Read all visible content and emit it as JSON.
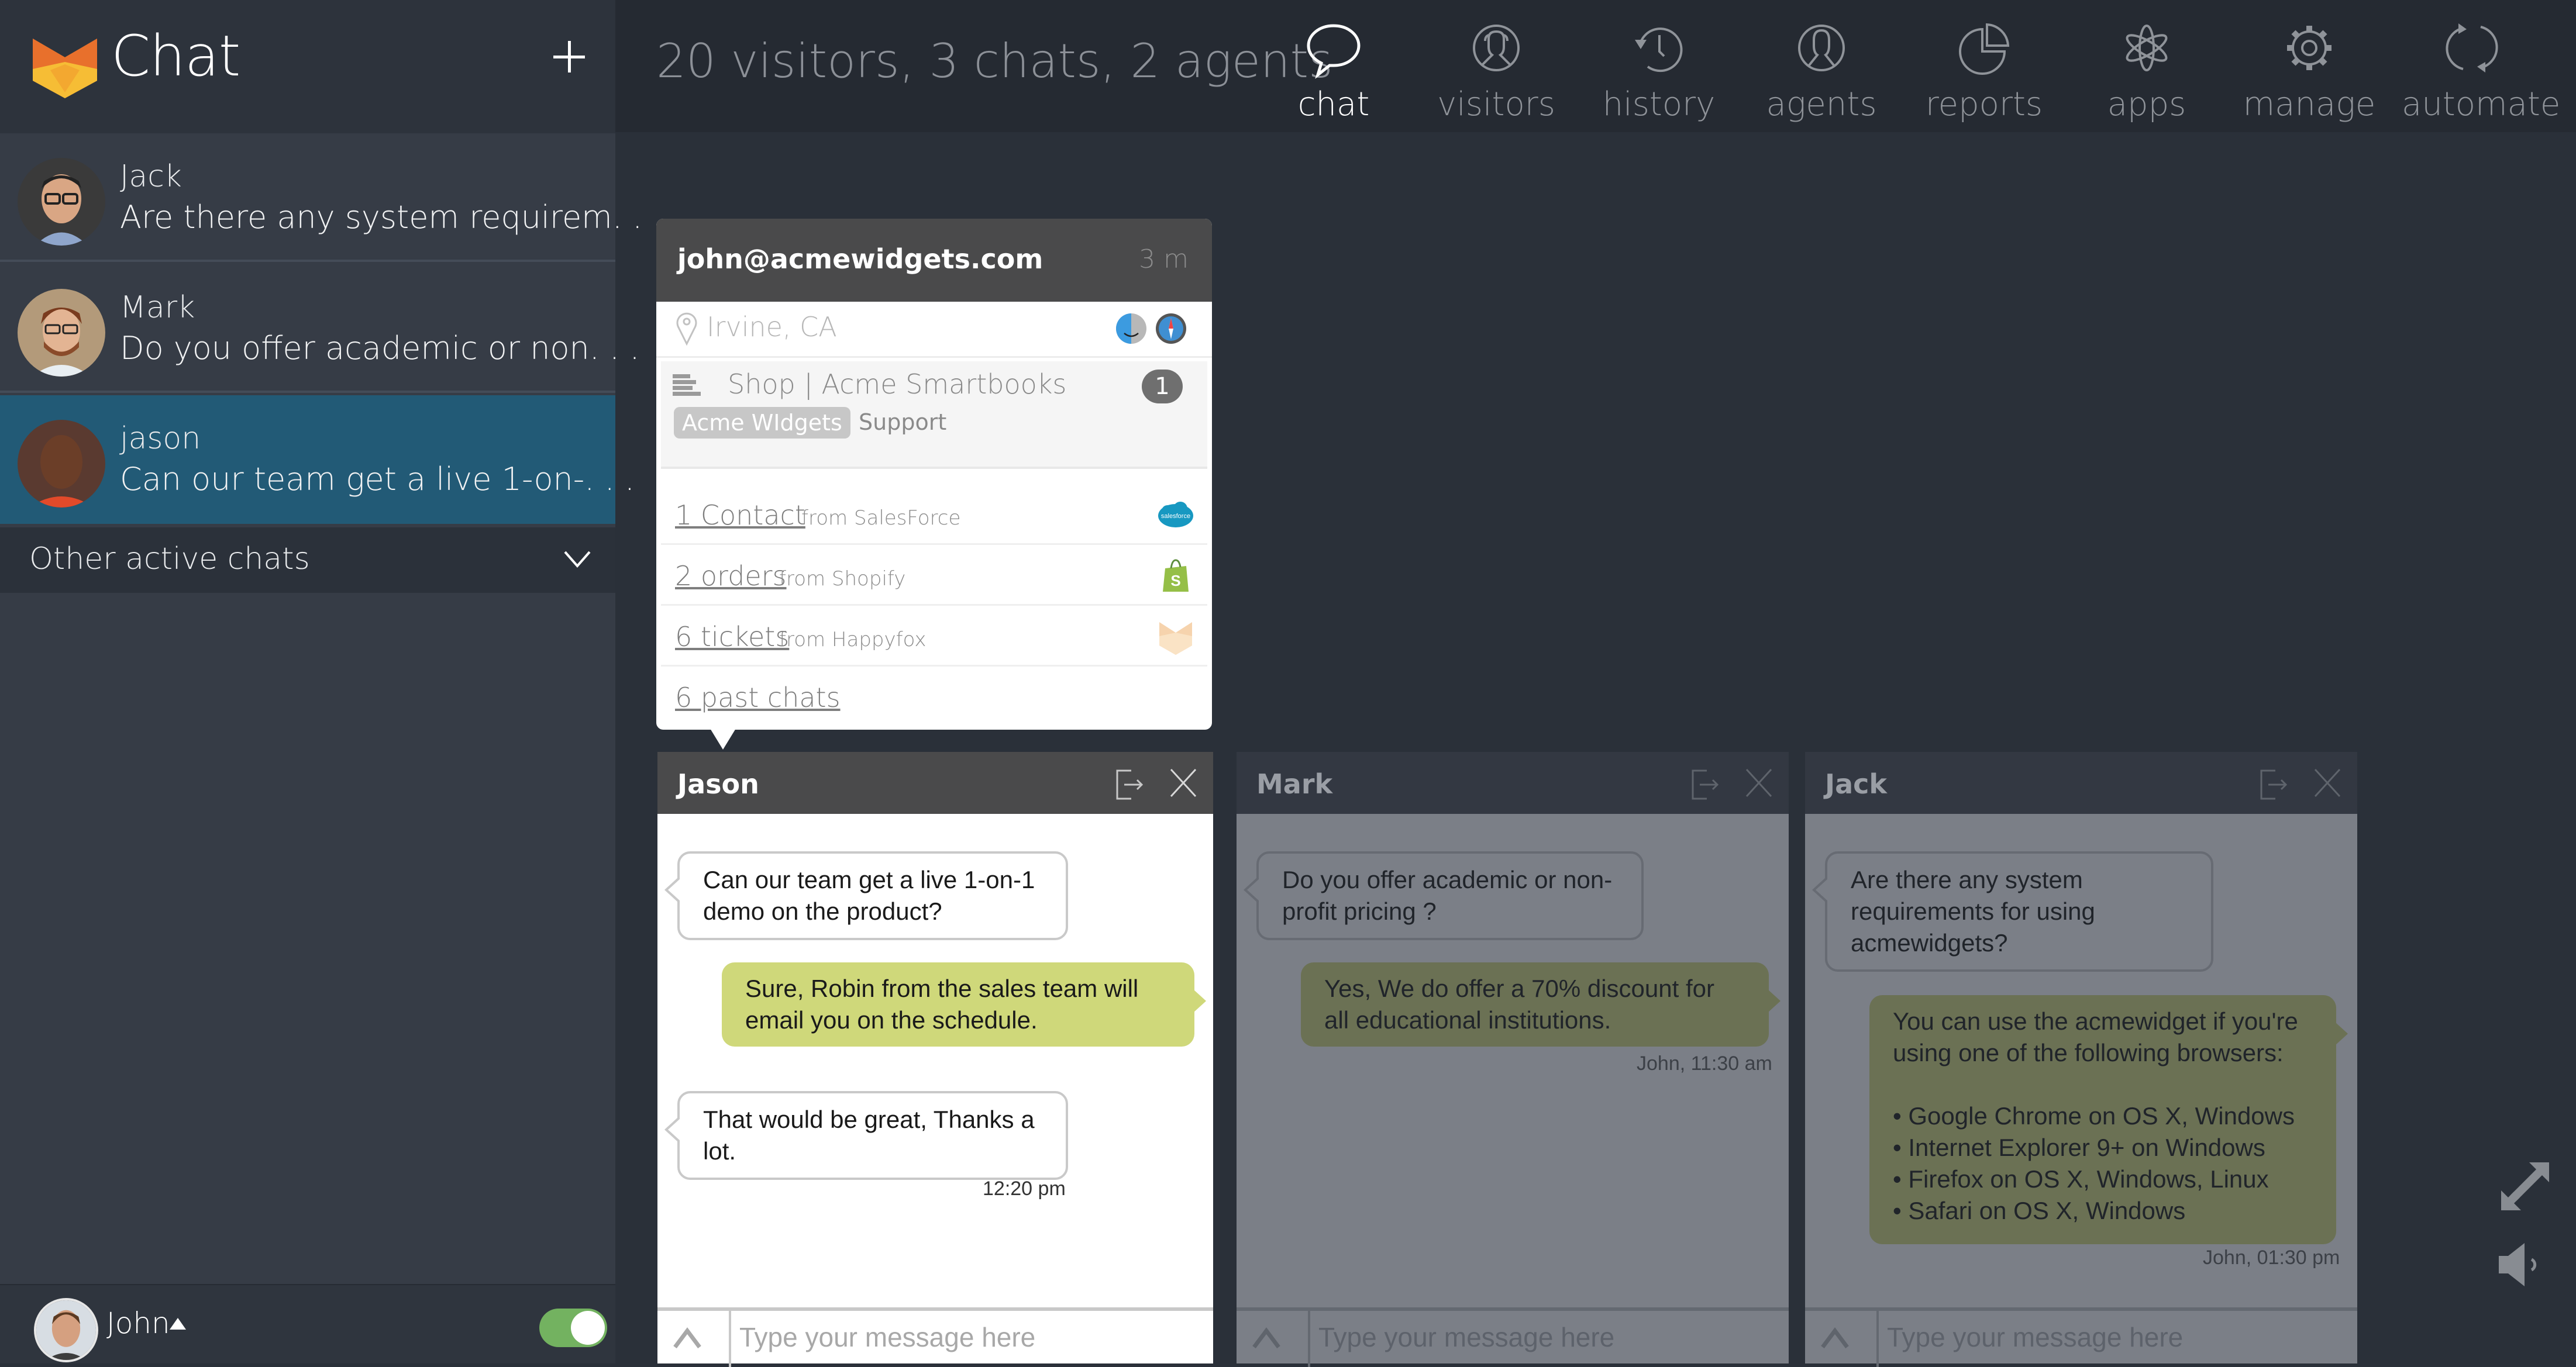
{
  "app": {
    "title": "Chat",
    "logo": "happyfox-logo",
    "new_chat_icon": "plus-icon"
  },
  "sidebar": {
    "chats": [
      {
        "name": "Jack",
        "preview": "Are there any system requirem. . .",
        "active": false
      },
      {
        "name": "Mark",
        "preview": "Do you offer academic or non. . .",
        "active": false
      },
      {
        "name": "jason",
        "preview": "Can our team get a live 1-on-. . .",
        "active": true
      }
    ],
    "other_active_chats": "Other active chats",
    "current_user": {
      "name": "John",
      "online": true
    }
  },
  "topbar": {
    "stats": "20 visitors, 3 chats, 2 agents",
    "nav": [
      {
        "label": "chat",
        "icon": "speech-bubble-icon",
        "active": true
      },
      {
        "label": "visitors",
        "icon": "visitors-icon",
        "active": false
      },
      {
        "label": "history",
        "icon": "history-icon",
        "active": false
      },
      {
        "label": "agents",
        "icon": "agent-icon",
        "active": false
      },
      {
        "label": "reports",
        "icon": "pie-chart-icon",
        "active": false
      },
      {
        "label": "apps",
        "icon": "atom-icon",
        "active": false
      },
      {
        "label": "manage",
        "icon": "gear-icon",
        "active": false
      },
      {
        "label": "automate",
        "icon": "refresh-icon",
        "active": false
      }
    ]
  },
  "visitor_card": {
    "email": "john@acmewidgets.com",
    "time": "3 m",
    "location": "Irvine, CA",
    "os": "finder-icon",
    "browser": "safari-icon",
    "page_title": "Shop | Acme Smartbooks",
    "page_count": "1",
    "tag": "Acme WIdgets",
    "department": "Support",
    "integrations": [
      {
        "link": "1 Contact",
        "source": "from SalesForce",
        "icon": "salesforce-icon"
      },
      {
        "link": "2 orders",
        "source": "from Shopify",
        "icon": "shopify-icon"
      },
      {
        "link": "6 tickets",
        "source": "from Happyfox",
        "icon": "happyfox-icon"
      }
    ],
    "past_chats": "6 past chats"
  },
  "panels": [
    {
      "name": "Jason",
      "placeholder": "Type your message here",
      "messages": [
        {
          "dir": "in",
          "text": "Can our team get a live 1-on-1 demo on the product?"
        },
        {
          "dir": "out",
          "text": "Sure, Robin from the sales team will email you on the schedule."
        },
        {
          "dir": "in",
          "text": "That would be great, Thanks a lot."
        }
      ],
      "timestamp": "12:20 pm"
    },
    {
      "name": "Mark",
      "placeholder": "Type your message here",
      "messages": [
        {
          "dir": "in",
          "text": "Do you offer academic or non-profit pricing ?"
        },
        {
          "dir": "out",
          "text": "Yes, We do offer a 70% discount for all educational institutions."
        }
      ],
      "timestamp": "John, 11:30 am"
    },
    {
      "name": "Jack",
      "placeholder": "Type your message here",
      "messages": [
        {
          "dir": "in",
          "text": "Are there any system requirements for using acmewidgets?"
        },
        {
          "dir": "out",
          "text": "You can use the acmewidget if you're using one of the following browsers:",
          "bullets": [
            "Google Chrome on OS X, Windows",
            "Internet Explorer 9+ on Windows",
            "Firefox on OS X, Windows, Linux",
            "Safari on OS X, Windows"
          ]
        }
      ],
      "timestamp": "John, 01:30 pm"
    }
  ],
  "colors": {
    "active_chat": "#225a76",
    "agent_bubble": "#cfd87a",
    "online_toggle": "#73b260",
    "sidebar": "#363c46",
    "canvas": "#2a3039"
  }
}
